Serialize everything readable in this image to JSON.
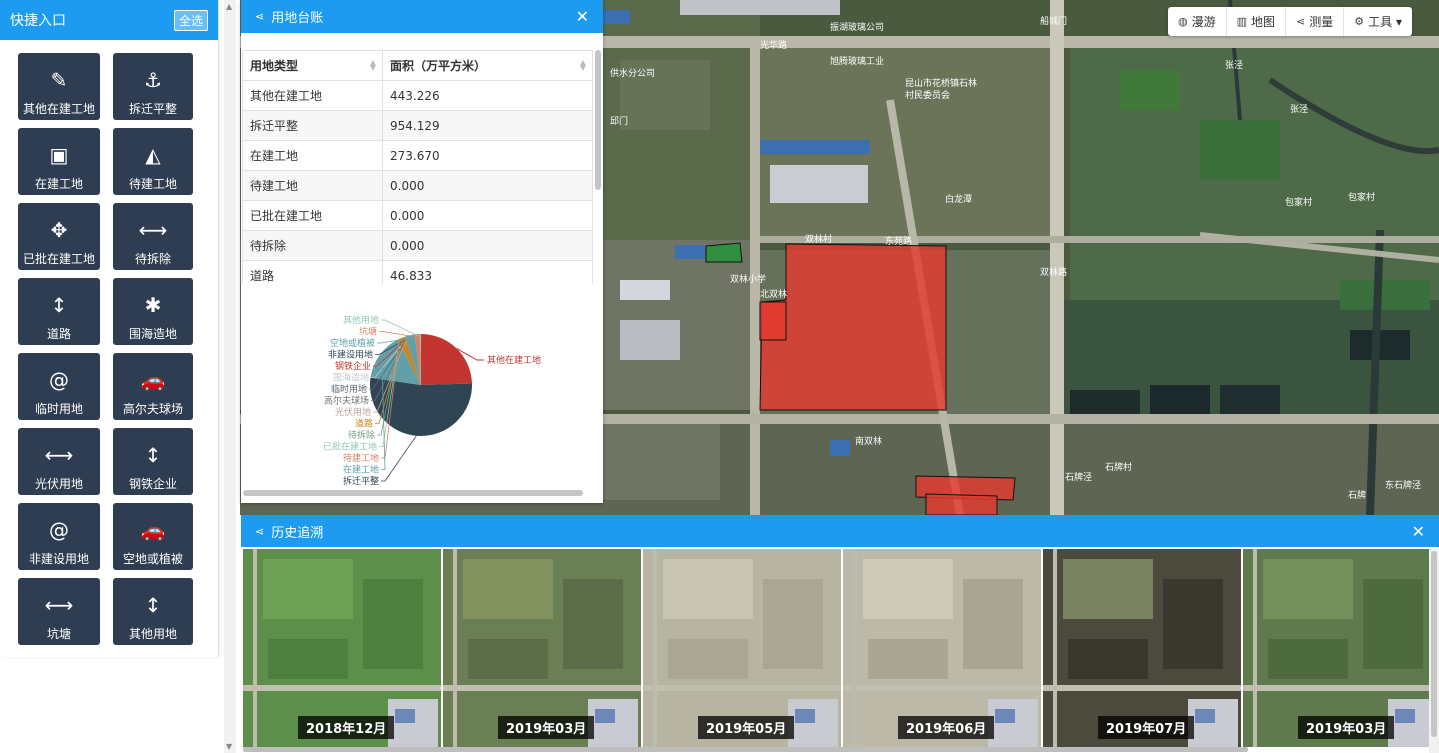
{
  "quick": {
    "title": "快捷入口",
    "all_label": "全选",
    "items": [
      {
        "label": "其他在建工地",
        "icon": "pencil-icon",
        "glyph": "✎"
      },
      {
        "label": "拆迁平整",
        "icon": "anchor-icon",
        "glyph": "⚓"
      },
      {
        "label": "在建工地",
        "icon": "archive-icon",
        "glyph": "▣"
      },
      {
        "label": "待建工地",
        "icon": "area-chart-icon",
        "glyph": "◭"
      },
      {
        "label": "已批在建工地",
        "icon": "move-icon",
        "glyph": "✥"
      },
      {
        "label": "待拆除",
        "icon": "arrows-h-icon",
        "glyph": "⟷"
      },
      {
        "label": "道路",
        "icon": "arrows-v-icon",
        "glyph": "↕"
      },
      {
        "label": "围海造地",
        "icon": "asterisk-icon",
        "glyph": "✱"
      },
      {
        "label": "临时用地",
        "icon": "at-icon",
        "glyph": "@"
      },
      {
        "label": "高尔夫球场",
        "icon": "car-icon",
        "glyph": "🚗"
      },
      {
        "label": "光伏用地",
        "icon": "arrows-h-icon",
        "glyph": "⟷"
      },
      {
        "label": "钢铁企业",
        "icon": "arrows-v-icon",
        "glyph": "↕"
      },
      {
        "label": "非建设用地",
        "icon": "at-icon",
        "glyph": "@"
      },
      {
        "label": "空地或植被",
        "icon": "car-icon",
        "glyph": "🚗"
      },
      {
        "label": "坑塘",
        "icon": "arrows-h-icon",
        "glyph": "⟷"
      },
      {
        "label": "其他用地",
        "icon": "arrows-v-icon",
        "glyph": "↕"
      }
    ]
  },
  "ledger": {
    "title": "用地台账",
    "close": "✕",
    "columns": [
      "用地类型",
      "面积（万平方米）"
    ],
    "rows": [
      [
        "其他在建工地",
        "443.226"
      ],
      [
        "拆迁平整",
        "954.129"
      ],
      [
        "在建工地",
        "273.670"
      ],
      [
        "待建工地",
        "0.000"
      ],
      [
        "已批在建工地",
        "0.000"
      ],
      [
        "待拆除",
        "0.000"
      ],
      [
        "道路",
        "46.833"
      ]
    ]
  },
  "chart_data": {
    "type": "pie",
    "slices": [
      {
        "name": "其他在建工地",
        "value": 443.226,
        "color": "#c23531"
      },
      {
        "name": "拆迁平整",
        "value": 954.129,
        "color": "#2f4554"
      },
      {
        "name": "在建工地",
        "value": 273.67,
        "color": "#61a0a8"
      },
      {
        "name": "待建工地",
        "value": 0,
        "color": "#d48265"
      },
      {
        "name": "已批在建工地",
        "value": 0,
        "color": "#91c7ae"
      },
      {
        "name": "待拆除",
        "value": 0,
        "color": "#749f83"
      },
      {
        "name": "道路",
        "value": 46.833,
        "color": "#ca8622"
      },
      {
        "name": "光伏用地",
        "value": 0,
        "color": "#bda29a"
      },
      {
        "name": "高尔夫球场",
        "value": 0,
        "color": "#6e7074"
      },
      {
        "name": "临时用地",
        "value": 0,
        "color": "#546570"
      },
      {
        "name": "围海造地",
        "value": 0,
        "color": "#c4ccd3"
      },
      {
        "name": "钢铁企业",
        "value": 0,
        "color": "#c23531"
      },
      {
        "name": "非建设用地",
        "value": 0,
        "color": "#2f4554"
      },
      {
        "name": "空地或植被",
        "value": 55,
        "color": "#61a0a8"
      },
      {
        "name": "坑塘",
        "value": 30,
        "color": "#d48265"
      },
      {
        "name": "其他用地",
        "value": 5,
        "color": "#91c7ae"
      }
    ]
  },
  "toolbar": {
    "items": [
      {
        "label": "漫游",
        "icon": "globe-icon",
        "glyph": "◍"
      },
      {
        "label": "地图",
        "icon": "map-icon",
        "glyph": "▥"
      },
      {
        "label": "测量",
        "icon": "share-icon",
        "glyph": "⋖"
      },
      {
        "label": "工具 ▾",
        "icon": "gears-icon",
        "glyph": "⚙"
      }
    ]
  },
  "map": {
    "labels": [
      "光华路",
      "船城门",
      "张泾",
      "昆山市花桥镇石林",
      "村民委员会",
      "旭腾玻璃工业",
      "白龙潭",
      "双林村",
      "东苑路",
      "双林小学",
      "北双林",
      "包家村",
      "包家村",
      "南双林",
      "石牌村",
      "石牌泾",
      "东石牌泾",
      "石牌",
      "张泾",
      "双林路",
      "供水分公司",
      "邱门",
      "振湖玻璃公司"
    ]
  },
  "history": {
    "title": "历史追溯",
    "close": "✕",
    "frames": [
      "2018年12月",
      "2019年03月",
      "2019年05月",
      "2019年06月",
      "2019年07月",
      "2019年03月"
    ]
  }
}
